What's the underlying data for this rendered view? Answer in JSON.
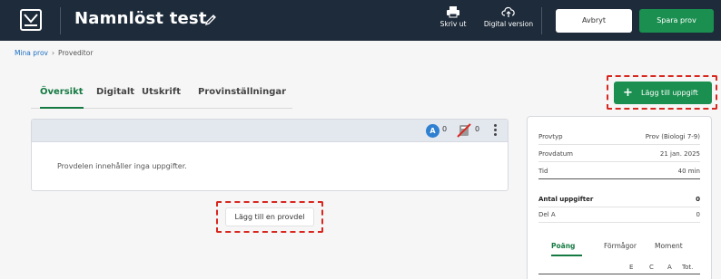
{
  "header": {
    "title": "Namnlöst test",
    "print_label": "Skriv ut",
    "digital_label": "Digital version",
    "cancel_label": "Avbryt",
    "save_label": "Spara prov",
    "colors": {
      "bar": "#1e2b3a",
      "save": "#1a8f4f"
    }
  },
  "breadcrumb": {
    "root": "Mina prov",
    "current": "Proveditor"
  },
  "tabs": [
    {
      "label": "Översikt",
      "active": true
    },
    {
      "label": "Digitalt",
      "active": false
    },
    {
      "label": "Utskrift",
      "active": false
    },
    {
      "label": "Provinställningar",
      "active": false
    }
  ],
  "add_task": {
    "label": "Lägg till uppgift",
    "icon": "plus-icon"
  },
  "section": {
    "badge_a": "A",
    "count_a": "0",
    "count_no_calculator": "0",
    "empty_text": "Provdelen innehåller inga uppgifter."
  },
  "add_part": {
    "label": "Lägg till en provdel"
  },
  "summary": {
    "rows": [
      {
        "key": "Provtyp",
        "value": "Prov (Biologi 7-9)"
      },
      {
        "key": "Provdatum",
        "value": "21 jan. 2025"
      },
      {
        "key": "Tid",
        "value": "40 min"
      },
      {
        "key": "Antal uppgifter",
        "value": "0"
      },
      {
        "key": "Del A",
        "value": "0"
      }
    ],
    "tabs": [
      {
        "label": "Poäng",
        "active": true
      },
      {
        "label": "Förmågor",
        "active": false
      },
      {
        "label": "Moment",
        "active": false
      }
    ],
    "columns": [
      "E",
      "C",
      "A",
      "Tot."
    ]
  },
  "highlight_color": "#d8271f"
}
